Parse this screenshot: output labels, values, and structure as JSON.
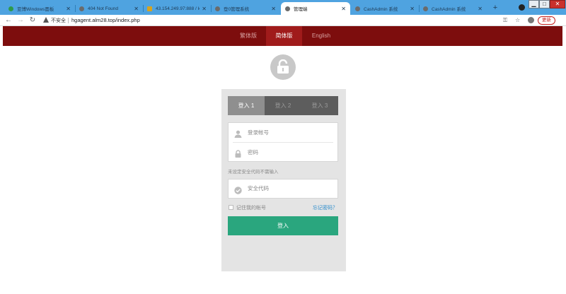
{
  "browser": {
    "tabs": [
      {
        "label": "亚博Windows面板",
        "favicon_color": "#2e9a4a",
        "active": false
      },
      {
        "label": "404 Not Found",
        "favicon_color": "#6b6b6b",
        "active": false
      },
      {
        "label": "43.154.249.97:888 / lo...",
        "favicon_color": "#d6a320",
        "active": false
      },
      {
        "label": "登0管理系统",
        "favicon_color": "#6b6b6b",
        "active": false
      },
      {
        "label": "管理端",
        "favicon_color": "#6b6b6b",
        "active": true
      },
      {
        "label": "CashAdmin 系统",
        "favicon_color": "#6b6b6b",
        "active": false
      },
      {
        "label": "CashAdmin 系统",
        "favicon_color": "#6b6b6b",
        "active": false
      }
    ],
    "new_tab": "+",
    "window_buttons": {
      "minimize": "▁",
      "restore": "□",
      "close": "✕"
    },
    "security_label": "不安全",
    "url": "hgagent.alm28.top/index.php",
    "update_label": "更新"
  },
  "page": {
    "languages": [
      {
        "label": "繁体版",
        "active": false
      },
      {
        "label": "简体版",
        "active": true
      },
      {
        "label": "English",
        "active": false
      }
    ],
    "login_tabs": [
      {
        "label": "登入 1",
        "active": true
      },
      {
        "label": "登入 2",
        "active": false
      },
      {
        "label": "登入 3",
        "active": false
      }
    ],
    "account_placeholder": "登录帐号",
    "password_placeholder": "密码",
    "security_note": "未设定安全代码不需输入",
    "security_code_placeholder": "安全代码",
    "remember_label": "记住我的帐号",
    "forgot_label": "忘记密码？",
    "login_button": "登入"
  },
  "colors": {
    "header_bar": "#7d0d0d",
    "active_language": "#a01b1b",
    "login_button": "#2aa67e",
    "tabstrip": "#4fa3e0"
  }
}
